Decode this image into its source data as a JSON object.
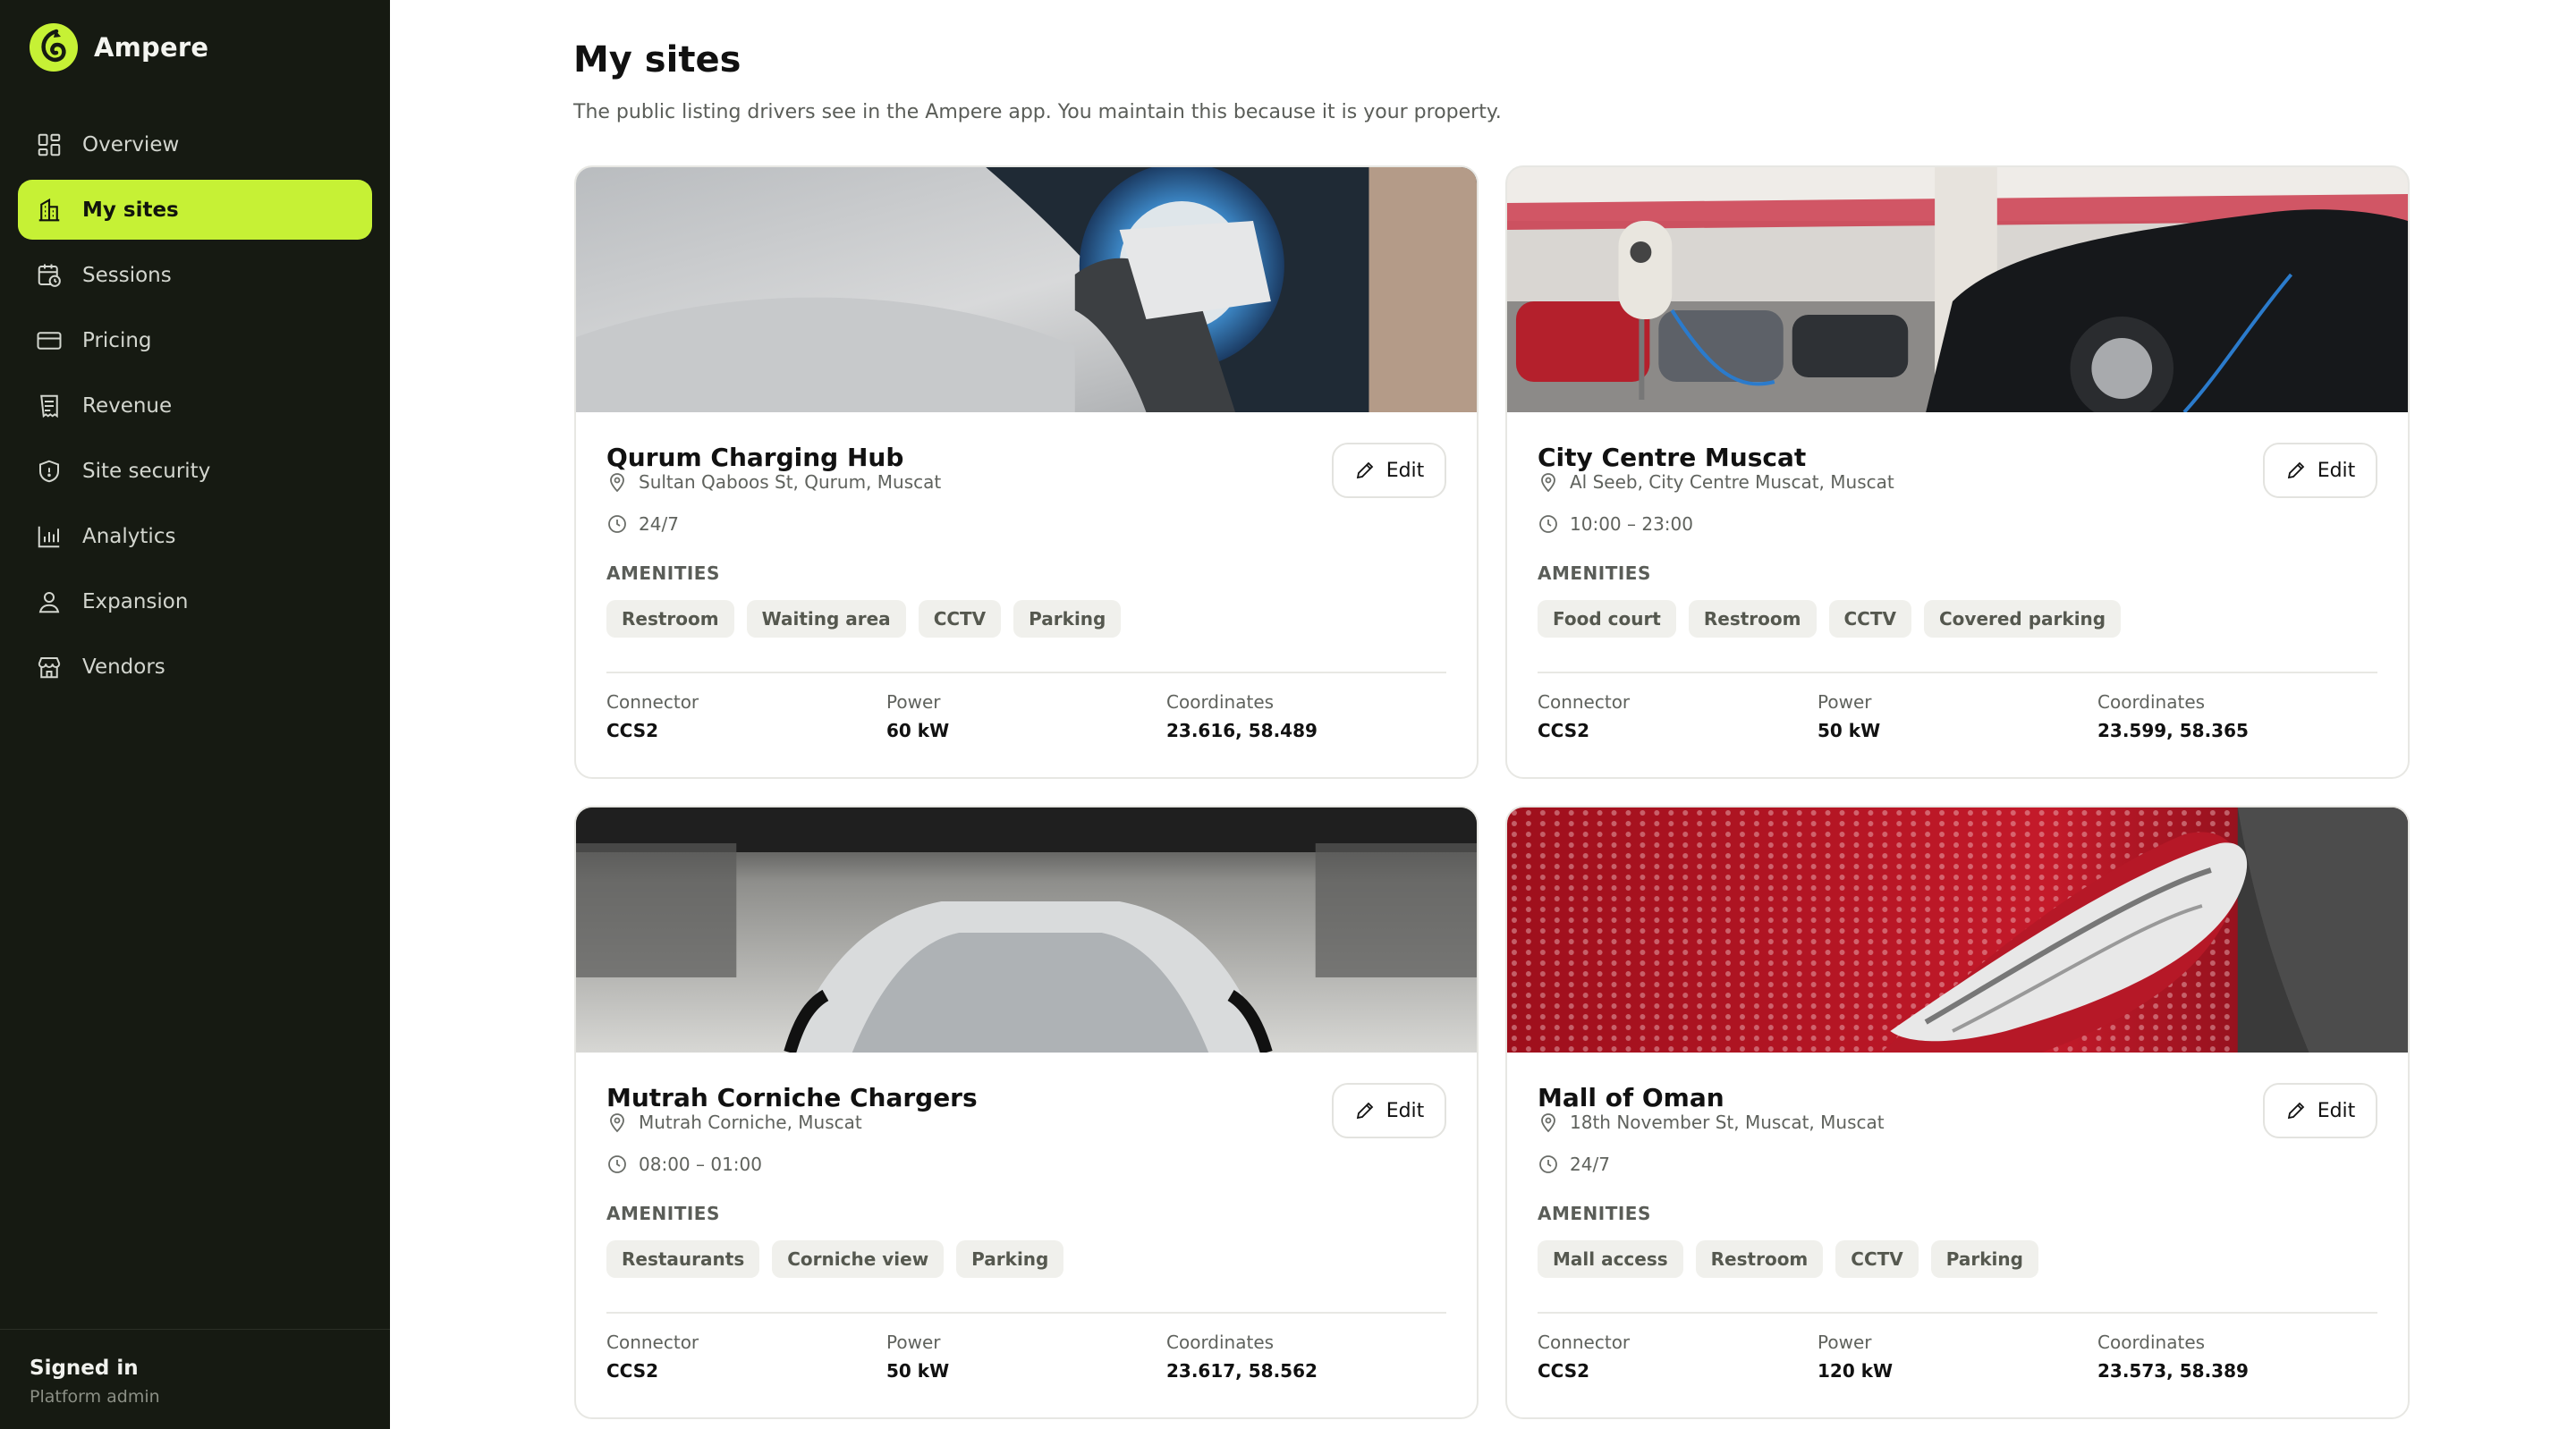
{
  "app": {
    "name": "Ampere",
    "accent": "#c6f135",
    "sidebar_bg": "#161a12"
  },
  "sidebar": {
    "items": [
      {
        "label": "Overview",
        "icon": "grid-icon",
        "active": false
      },
      {
        "label": "My sites",
        "icon": "building-icon",
        "active": true
      },
      {
        "label": "Sessions",
        "icon": "calendar-clock-icon",
        "active": false
      },
      {
        "label": "Pricing",
        "icon": "credit-card-icon",
        "active": false
      },
      {
        "label": "Revenue",
        "icon": "receipt-icon",
        "active": false
      },
      {
        "label": "Site security",
        "icon": "shield-icon",
        "active": false
      },
      {
        "label": "Analytics",
        "icon": "bar-chart-icon",
        "active": false
      },
      {
        "label": "Expansion",
        "icon": "user-pin-icon",
        "active": false
      },
      {
        "label": "Vendors",
        "icon": "store-icon",
        "active": false
      }
    ],
    "footer": {
      "title": "Signed in",
      "role": "Platform admin"
    }
  },
  "page": {
    "title": "My sites",
    "subtitle": "The public listing drivers see in the Ampere app. You maintain this because it is your property."
  },
  "labels": {
    "edit": "Edit",
    "amenities": "AMENITIES",
    "connector": "Connector",
    "power": "Power",
    "coordinates": "Coordinates"
  },
  "sites": [
    {
      "name": "Qurum Charging Hub",
      "address": "Sultan Qaboos St, Qurum, Muscat",
      "hours": "24/7",
      "amenities": [
        "Restroom",
        "Waiting area",
        "CCTV",
        "Parking"
      ],
      "connector": "CCS2",
      "power": "60 kW",
      "coordinates": "23.616, 58.489"
    },
    {
      "name": "City Centre Muscat",
      "address": "Al Seeb, City Centre Muscat, Muscat",
      "hours": "10:00 – 23:00",
      "amenities": [
        "Food court",
        "Restroom",
        "CCTV",
        "Covered parking"
      ],
      "connector": "CCS2",
      "power": "50 kW",
      "coordinates": "23.599, 58.365"
    },
    {
      "name": "Mutrah Corniche Chargers",
      "address": "Mutrah Corniche, Muscat",
      "hours": "08:00 – 01:00",
      "amenities": [
        "Restaurants",
        "Corniche view",
        "Parking"
      ],
      "connector": "CCS2",
      "power": "50 kW",
      "coordinates": "23.617, 58.562"
    },
    {
      "name": "Mall of Oman",
      "address": "18th November St, Muscat, Muscat",
      "hours": "24/7",
      "amenities": [
        "Mall access",
        "Restroom",
        "CCTV",
        "Parking"
      ],
      "connector": "CCS2",
      "power": "120 kW",
      "coordinates": "23.573, 58.389"
    }
  ]
}
